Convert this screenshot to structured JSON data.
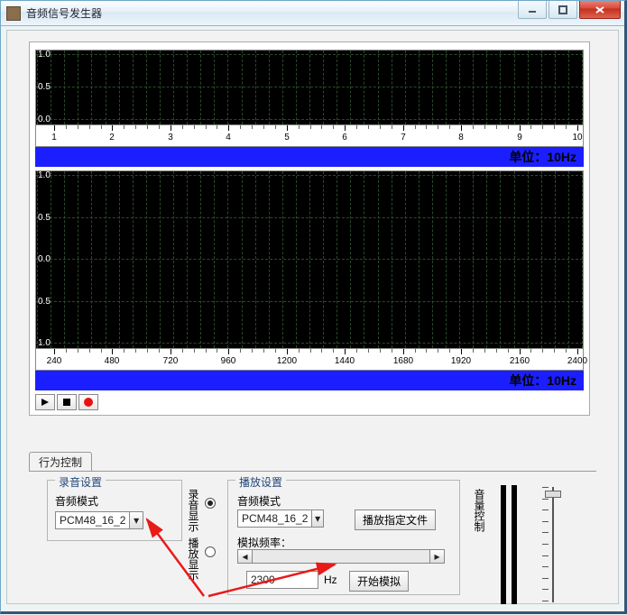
{
  "window": {
    "title": "音频信号发生器"
  },
  "scope_top": {
    "y_ticks": [
      "1.0",
      "0.5",
      "0.0"
    ],
    "x_ticks": [
      "1",
      "2",
      "3",
      "4",
      "5",
      "6",
      "7",
      "8",
      "9",
      "10"
    ],
    "unit_label": "单位：10Hz"
  },
  "scope_bottom": {
    "y_ticks": [
      "1.0",
      "0.5",
      "0.0",
      "0.5",
      "1.0"
    ],
    "x_ticks": [
      "240",
      "480",
      "720",
      "960",
      "1200",
      "1440",
      "1680",
      "1920",
      "2160",
      "2400"
    ],
    "unit_label": "单位：10Hz"
  },
  "tabs": {
    "behavior": "行为控制"
  },
  "record_group": {
    "legend": "录音设置",
    "mode_label": "音频模式",
    "mode_value": "PCM48_16_2"
  },
  "radio_col": {
    "rec_label": "录音显示",
    "play_label": "播放显示"
  },
  "play_group": {
    "legend": "播放设置",
    "mode_label": "音频模式",
    "mode_value": "PCM48_16_2",
    "play_file_btn": "播放指定文件",
    "sim_freq_label": "模拟频率：",
    "sim_freq_value": "2300",
    "sim_freq_unit": "Hz",
    "start_sim_btn": "开始模拟"
  },
  "volume": {
    "label": "音量控制"
  }
}
